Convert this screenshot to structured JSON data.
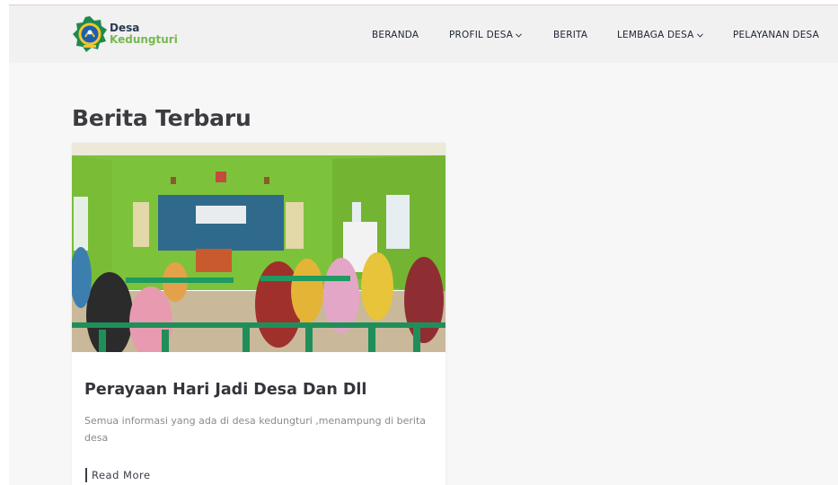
{
  "header": {
    "brand": {
      "line1": "Desa",
      "line2": "Kedungturi"
    },
    "nav": [
      {
        "label": "BERANDA",
        "has_dropdown": false
      },
      {
        "label": "PROFIL DESA",
        "has_dropdown": true
      },
      {
        "label": "BERITA",
        "has_dropdown": false
      },
      {
        "label": "LEMBAGA DESA",
        "has_dropdown": true
      },
      {
        "label": "PELAYANAN DESA",
        "has_dropdown": false
      }
    ]
  },
  "main": {
    "heading": "Berita Terbaru",
    "posts": [
      {
        "title": "Perayaan Hari Jadi Desa Dan Dll",
        "excerpt": "Semua informasi yang ada di desa kedungturi ,menampung di berita desa",
        "read_more": "Read More"
      }
    ]
  },
  "colors": {
    "brand_green": "#77b84e",
    "brand_navy": "#2a3a52",
    "navbar_bg": "#f1f1f1",
    "page_bg": "#f7f7f7"
  }
}
